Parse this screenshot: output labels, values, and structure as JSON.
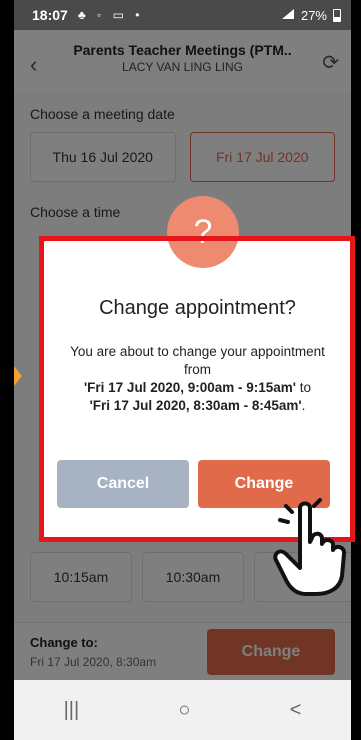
{
  "status_bar": {
    "time": "18:07",
    "left_icons": "♣ ◦ ▭ •",
    "right_text": "27%",
    "battery_level": 0.27
  },
  "header": {
    "title": "Parents Teacher Meetings (PTM..",
    "subtitle": "LACY VAN LING LING",
    "back_icon": "chevron-left-icon",
    "refresh_icon": "refresh-icon"
  },
  "date_section": {
    "label": "Choose a meeting date",
    "dates": [
      {
        "label": "Thu 16 Jul 2020",
        "selected": false
      },
      {
        "label": "Fri 17 Jul 2020",
        "selected": true
      }
    ]
  },
  "time_section": {
    "label": "Choose a time",
    "times": [
      "10:15am",
      "10:30am",
      ""
    ]
  },
  "footer": {
    "change_to_label": "Change to:",
    "change_to_value": "Fri 17 Jul 2020, 8:30am",
    "change_button": "Change"
  },
  "dialog": {
    "icon": "question-icon",
    "icon_glyph": "?",
    "title": "Change appointment?",
    "body_line1": "You are about to change your appointment from",
    "from_value": "'Fri 17 Jul 2020, 9:00am - 9:15am'",
    "to_word": "to",
    "to_value": "'Fri 17 Jul 2020, 8:30am - 8:45am'",
    "period": ".",
    "cancel_label": "Cancel",
    "change_label": "Change"
  },
  "navbar": {
    "recents_glyph": "|||",
    "home_glyph": "○",
    "back_glyph": "<"
  },
  "colors": {
    "accent": "#e06a4a",
    "cancel": "#a7b2c2",
    "highlight": "#e8141c"
  }
}
